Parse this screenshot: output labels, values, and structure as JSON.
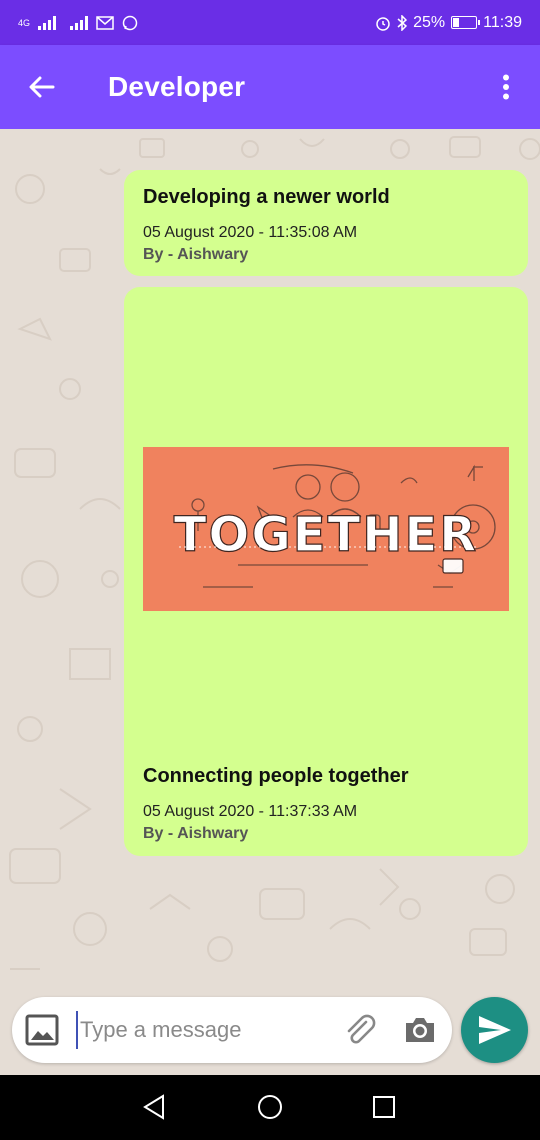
{
  "status_bar": {
    "network_type": "4G",
    "battery": "25%",
    "time": "11:39"
  },
  "app_bar": {
    "title": "Developer",
    "back_icon": "arrow-back-icon",
    "menu_icon": "more-vert-icon"
  },
  "messages": [
    {
      "title": "Developing a newer world",
      "date": "05 August 2020 - 11:35:08 AM",
      "by": "By - Aishwary"
    },
    {
      "title": "Connecting people together",
      "date": "05 August 2020 - 11:37:33 AM",
      "by": "By - Aishwary",
      "image_text": "TOGETHER"
    }
  ],
  "input": {
    "placeholder": "Type a message",
    "gallery_icon": "image-icon",
    "attach_icon": "paperclip-icon",
    "camera_icon": "camera-icon",
    "send_icon": "send-icon"
  },
  "colors": {
    "status_bar": "#6a2ee6",
    "app_bar": "#7c4dff",
    "bubble": "#d4ff8f",
    "send": "#1d8f83",
    "image_bg": "#f0825e"
  }
}
